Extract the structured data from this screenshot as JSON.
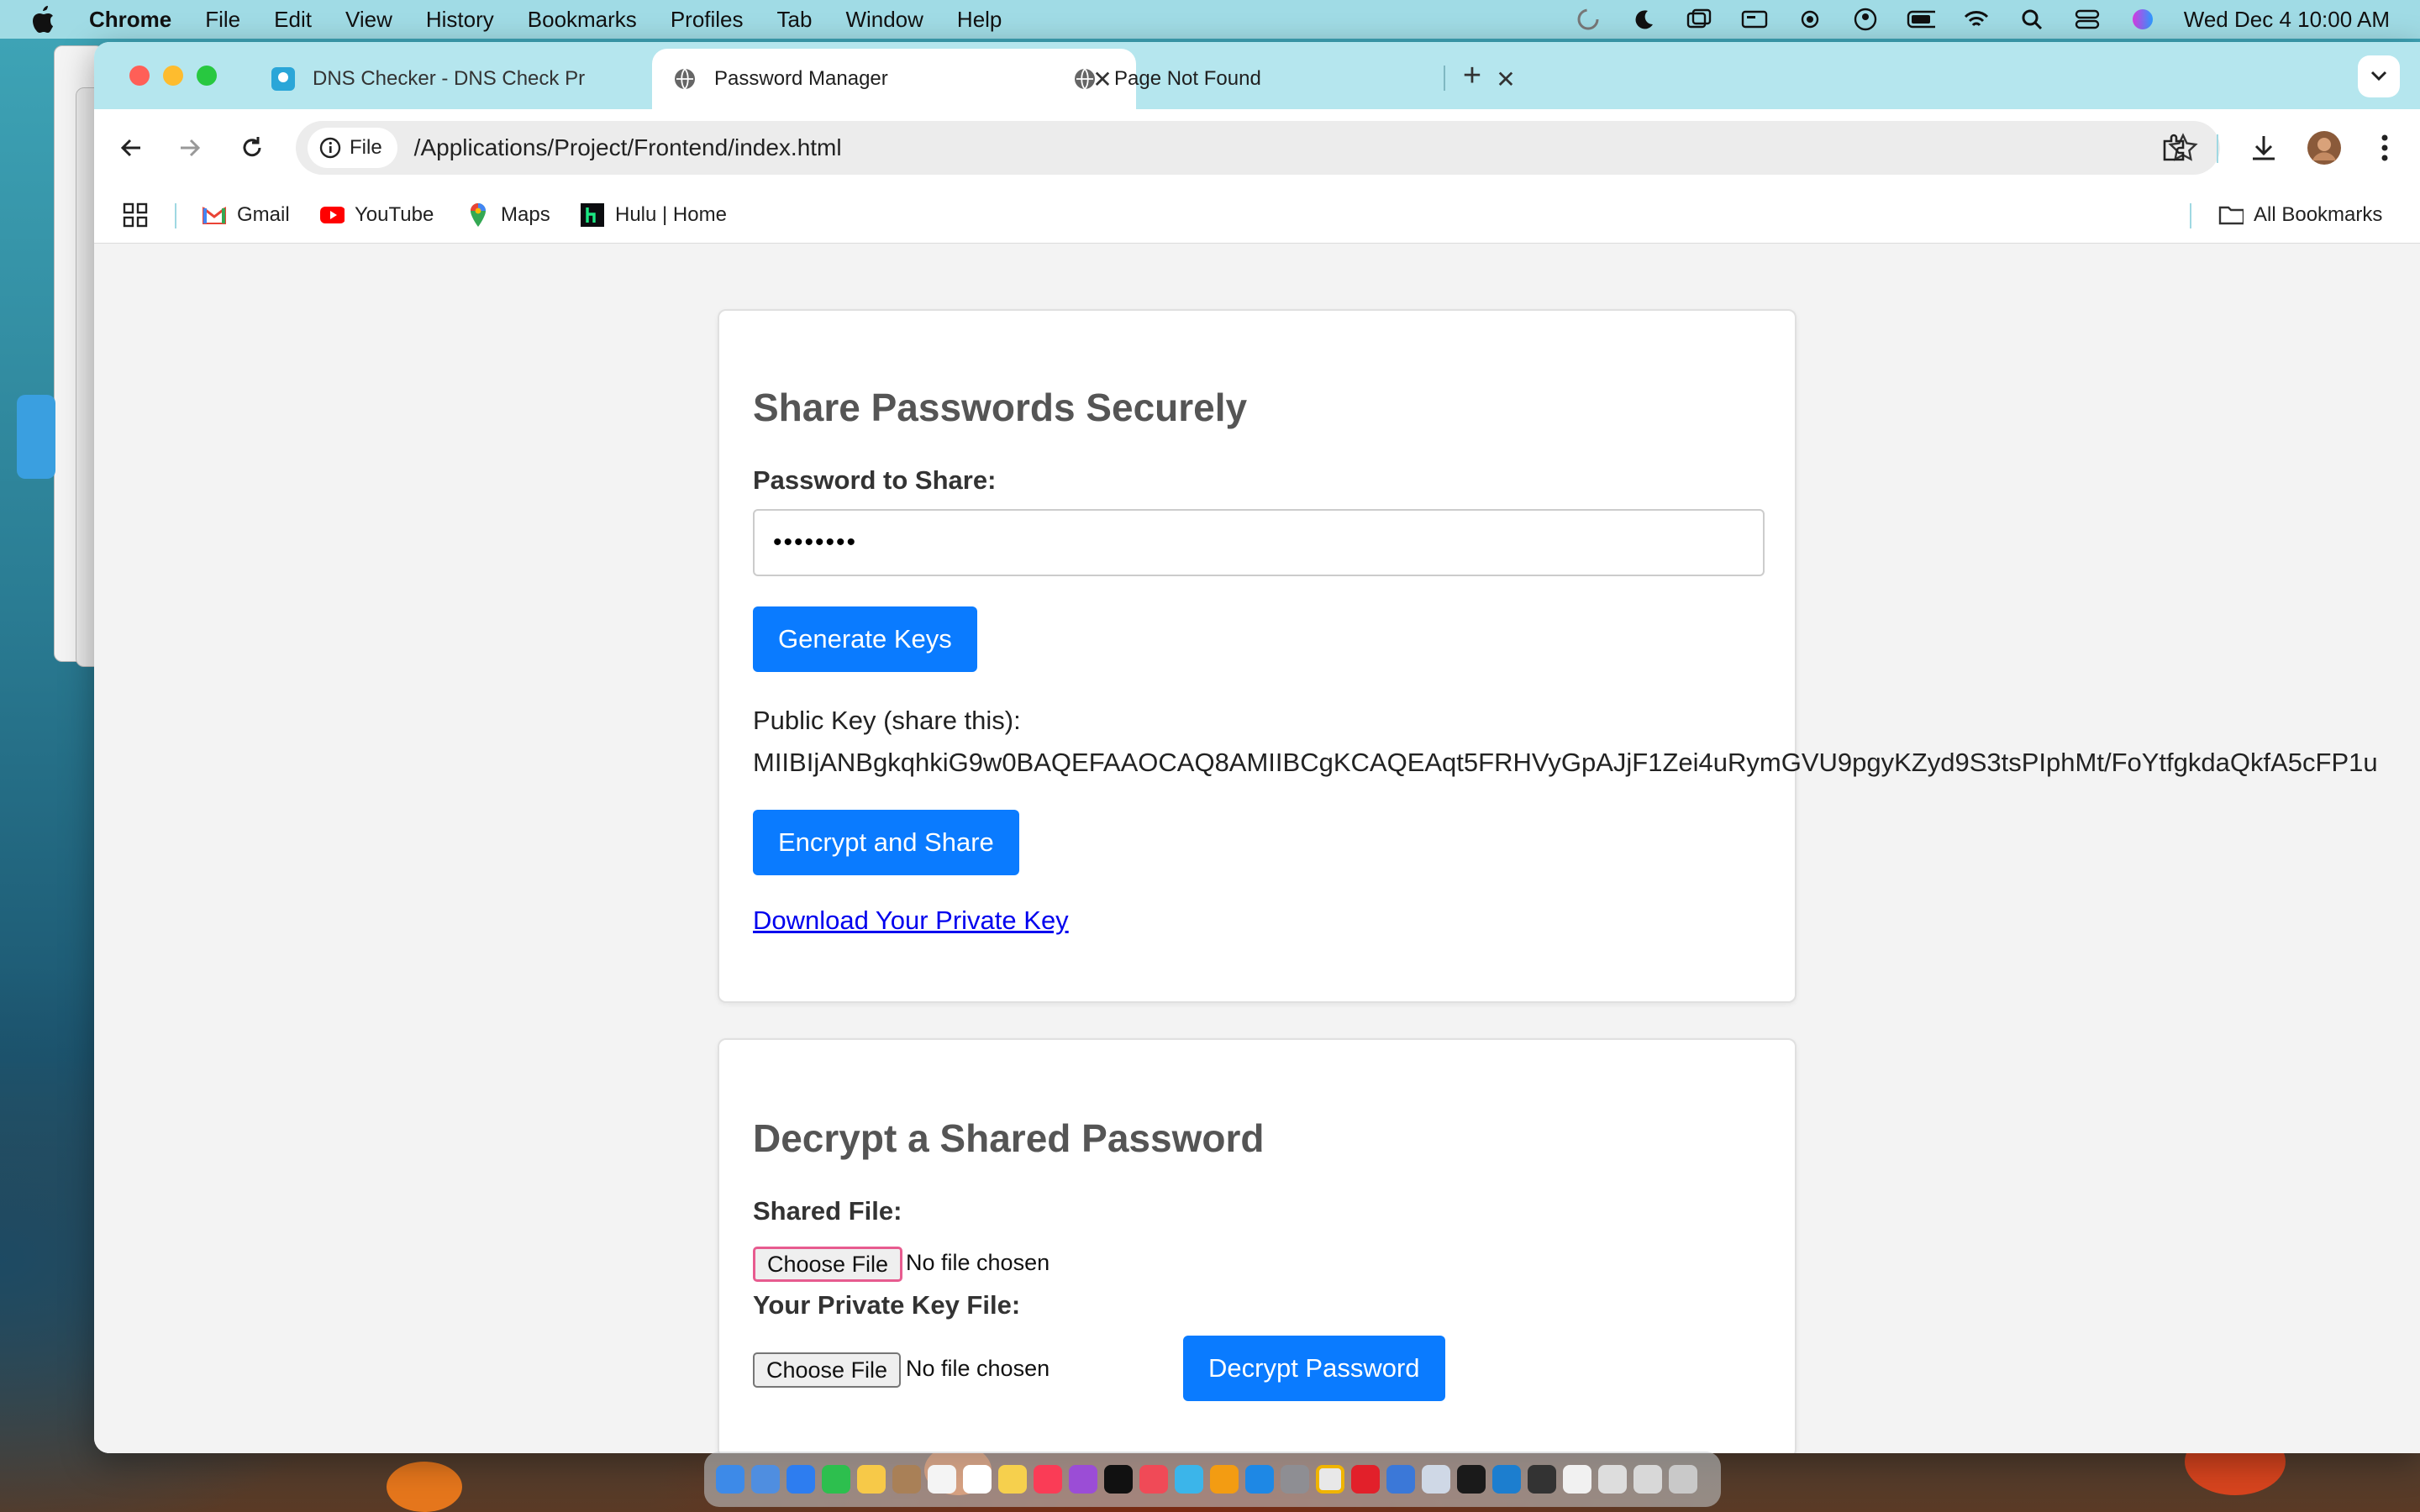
{
  "menubar": {
    "app_name": "Chrome",
    "menus": [
      "File",
      "Edit",
      "View",
      "History",
      "Bookmarks",
      "Profiles",
      "Tab",
      "Window",
      "Help"
    ],
    "datetime": "Wed Dec 4  10:00 AM"
  },
  "tabs": [
    {
      "title": "DNS Checker - DNS Check Pr",
      "icon": "dns-checker-icon",
      "active": false
    },
    {
      "title": "Password Manager",
      "icon": "globe-icon",
      "active": true
    },
    {
      "title": "Page Not Found",
      "icon": "globe-icon",
      "active": false
    }
  ],
  "toolbar": {
    "site_chip": "File",
    "url": "/Applications/Project/Frontend/index.html"
  },
  "bookmarks": {
    "items": [
      {
        "label": "Gmail",
        "icon": "gmail-icon"
      },
      {
        "label": "YouTube",
        "icon": "youtube-icon"
      },
      {
        "label": "Maps",
        "icon": "maps-icon"
      },
      {
        "label": "Hulu | Home",
        "icon": "hulu-icon"
      }
    ],
    "all_bookmarks": "All Bookmarks"
  },
  "share_card": {
    "title": "Share Passwords Securely",
    "password_label": "Password to Share:",
    "password_value": "••••••••",
    "generate_button": "Generate Keys",
    "public_key_label": "Public Key (share this):",
    "public_key_value": "MIIBIjANBgkqhkiG9w0BAQEFAAOCAQ8AMIIBCgKCAQEAqt5FRHVyGpAJjF1Zei4uRymGVU9pgyKZyd9S3tsPIphMt/FoYtfgkdaQkfA5cFP1u",
    "encrypt_button": "Encrypt and Share",
    "download_link": "Download Your Private Key"
  },
  "decrypt_card": {
    "title": "Decrypt a Shared Password",
    "shared_file_label": "Shared File:",
    "private_key_label": "Your Private Key File:",
    "choose_file": "Choose File",
    "no_file": "No file chosen",
    "decrypt_button": "Decrypt Password"
  },
  "colors": {
    "primary_button": "#0a7bff",
    "link": "#0000ee",
    "tabstrip": "#b5e6ee"
  }
}
